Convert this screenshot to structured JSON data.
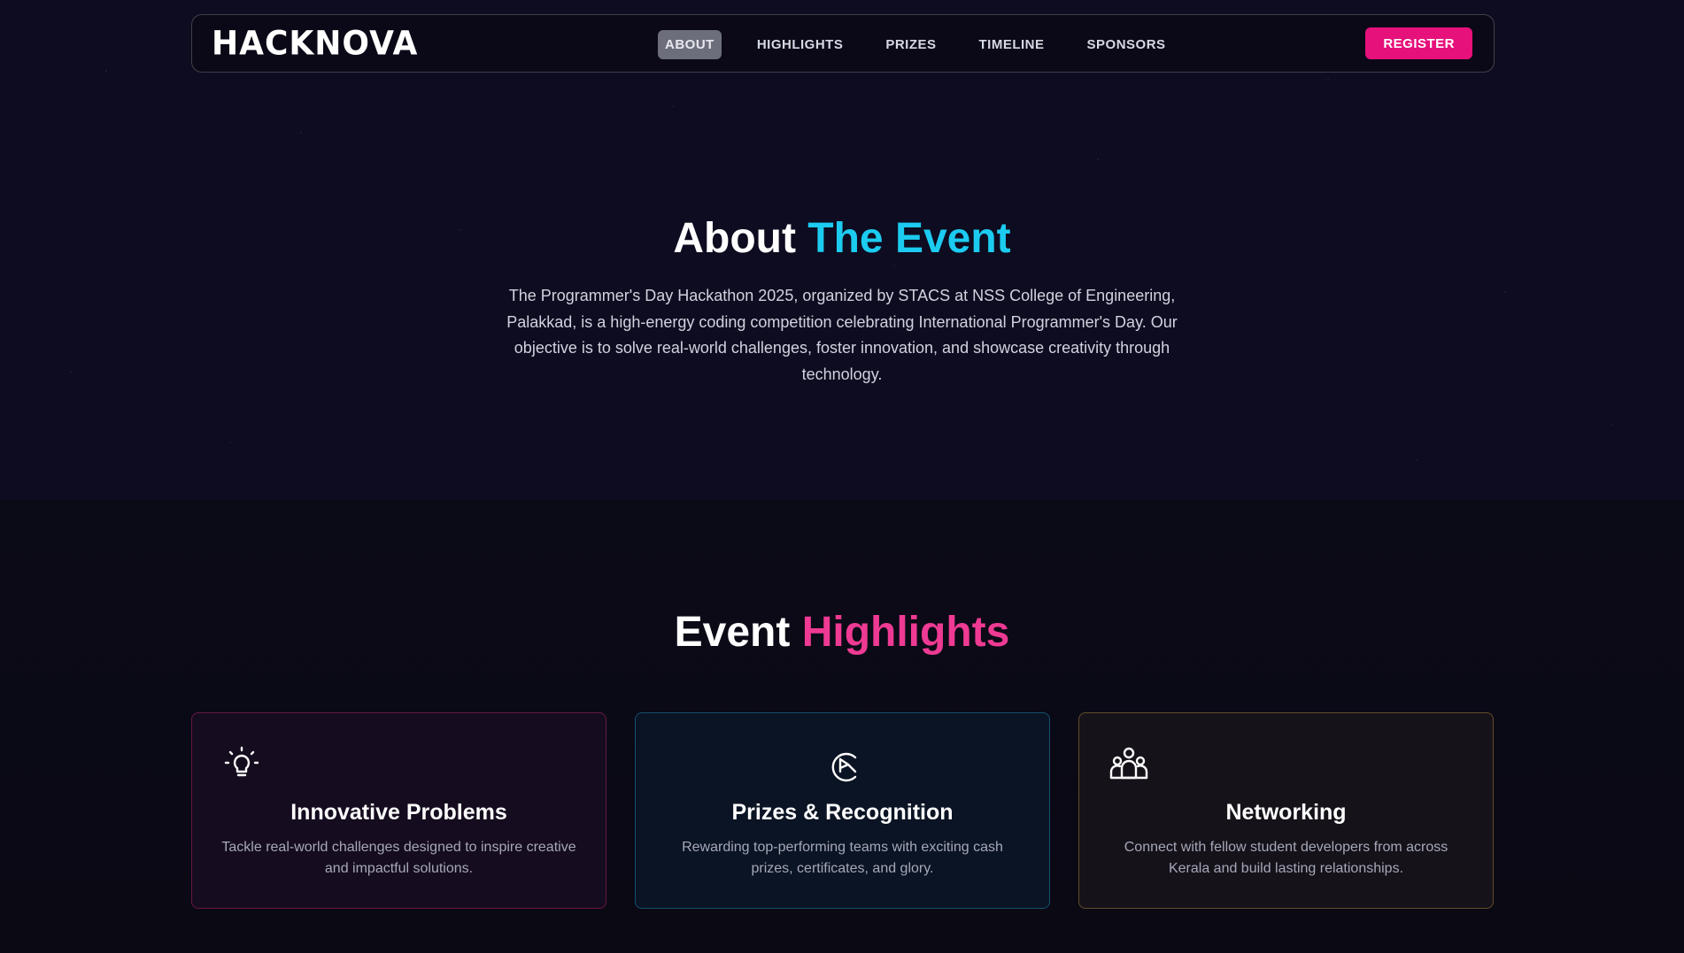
{
  "nav": {
    "logo": "HACKNOVA",
    "links": [
      "ABOUT",
      "HIGHLIGHTS",
      "PRIZES",
      "TIMELINE",
      "SPONSORS"
    ],
    "active": "ABOUT",
    "register": "REGISTER"
  },
  "about": {
    "title_plain": "About",
    "title_accent": "The Event",
    "text": "The Programmer's Day Hackathon 2025, organized by STACS at NSS College of Engineering, Palakkad, is a high-energy coding competition celebrating International Programmer's Day. Our objective is to solve real-world challenges, foster innovation, and showcase creativity through technology."
  },
  "highlights": {
    "title_plain": "Event",
    "title_accent": "Highlights",
    "cards": [
      {
        "icon": "lightbulb-icon",
        "title": "Innovative Problems",
        "desc": "Tackle real-world challenges designed to inspire creative and impactful solutions."
      },
      {
        "icon": "award-icon",
        "title": "Prizes & Recognition",
        "desc": "Rewarding top-performing teams with exciting cash prizes, certificates, and glory."
      },
      {
        "icon": "users-icon",
        "title": "Networking",
        "desc": "Connect with fellow student developers from across Kerala and build lasting relationships."
      }
    ]
  },
  "colors": {
    "background": "#0c0b1a",
    "accent_cyan": "#1ccbf0",
    "accent_pink": "#ee3a93",
    "register": "#e6117b"
  }
}
